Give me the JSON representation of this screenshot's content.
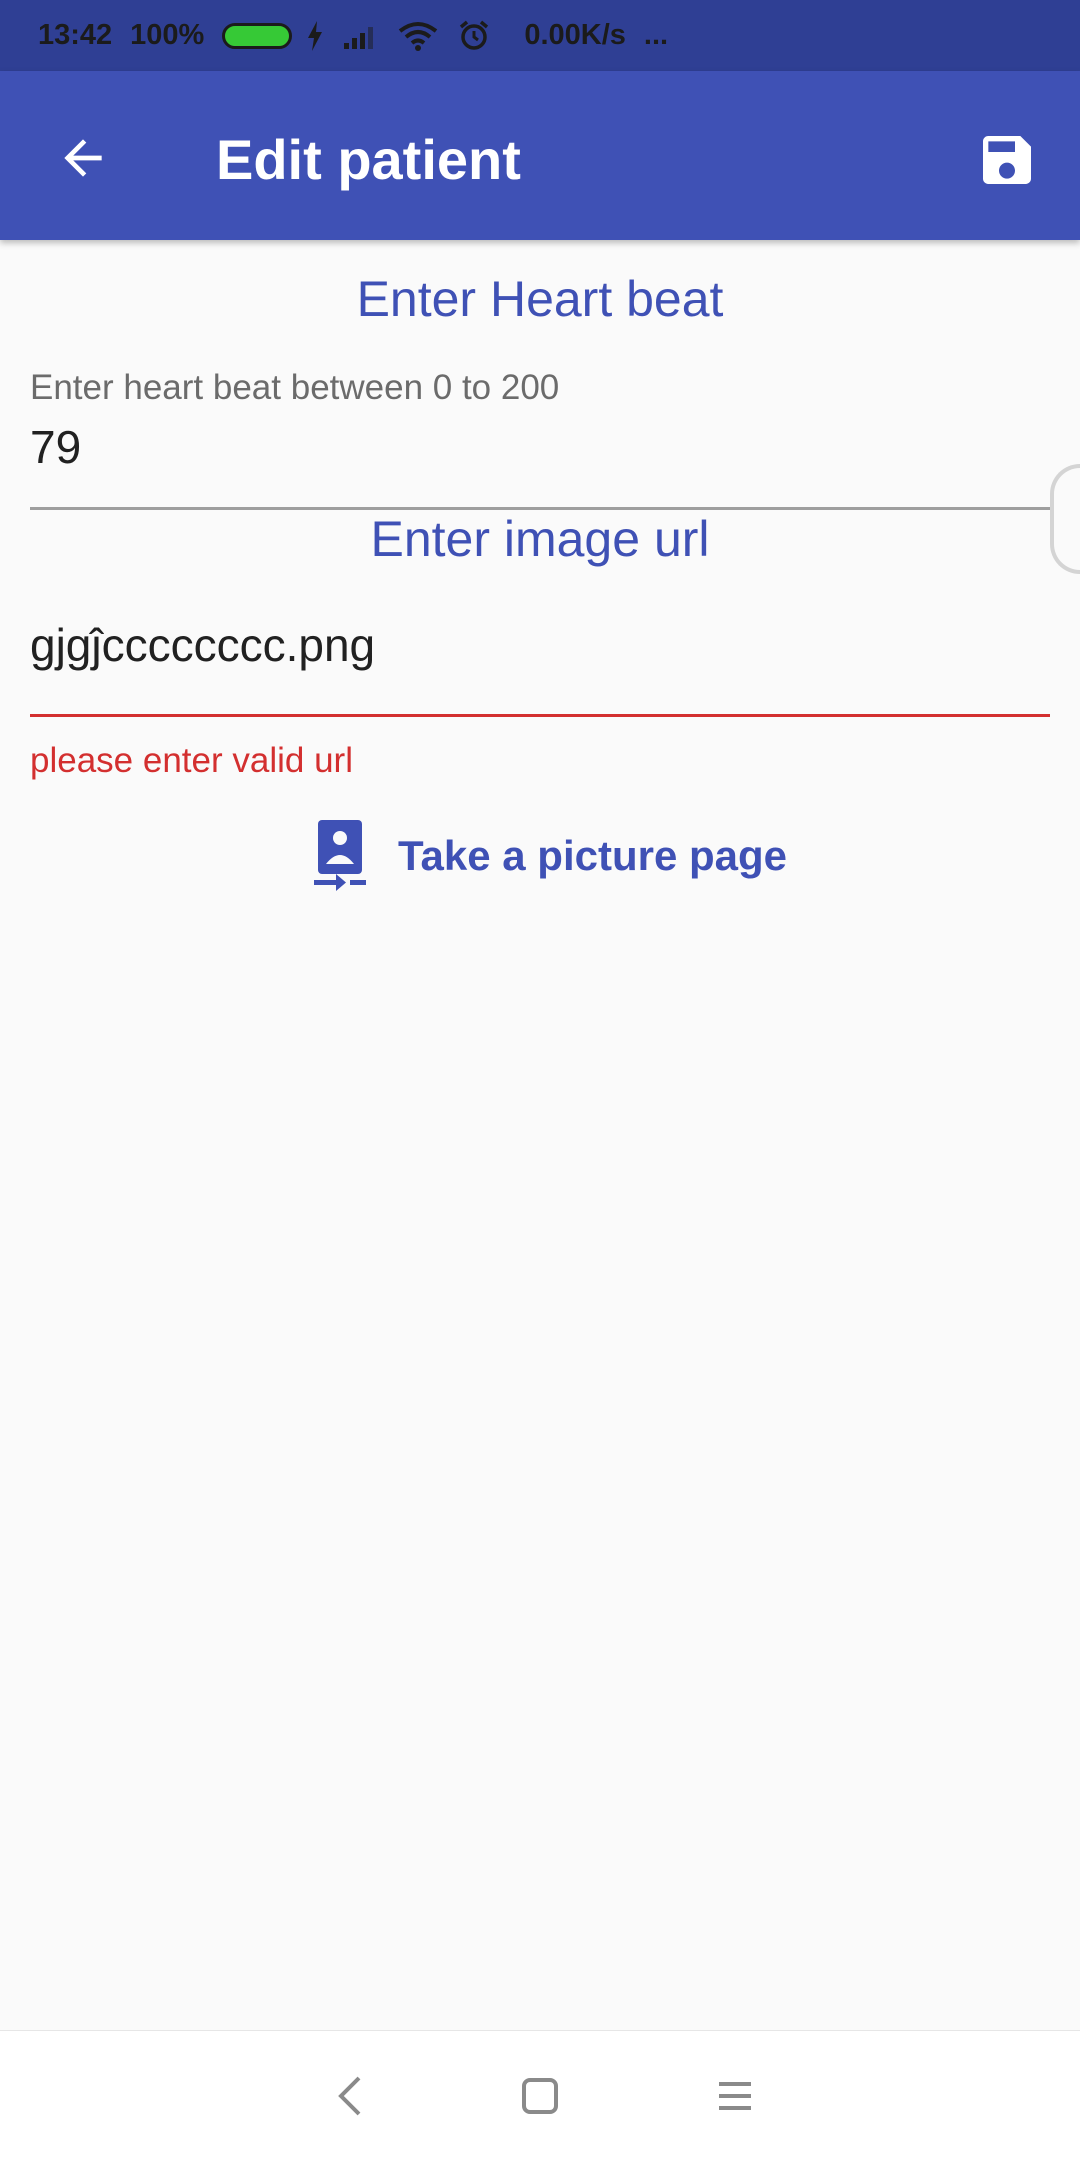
{
  "status_bar": {
    "time": "13:42",
    "battery_percent": "100%",
    "battery_level": 1.0,
    "network_speed": "0.00K/s",
    "more_indicator": "...",
    "icons": [
      "charging-icon",
      "signal-icon",
      "wifi-icon",
      "alarm-icon"
    ]
  },
  "app_bar": {
    "title": "Edit patient",
    "back_icon": "arrow-back-icon",
    "save_icon": "save-icon",
    "color": "#3f51b5"
  },
  "heart_beat": {
    "heading": "Enter Heart beat",
    "label": "Enter heart beat between 0 to 200",
    "value": "79"
  },
  "image_url": {
    "heading": "Enter image url",
    "value": "gjgĵcccccccc.png",
    "error": "please enter valid url",
    "error_color": "#d32f2f"
  },
  "picture_button": {
    "label": "Take a picture page",
    "icon": "camera-front-icon"
  },
  "nav_bar": {
    "icons": [
      "nav-back-icon",
      "nav-home-icon",
      "nav-menu-icon"
    ]
  }
}
